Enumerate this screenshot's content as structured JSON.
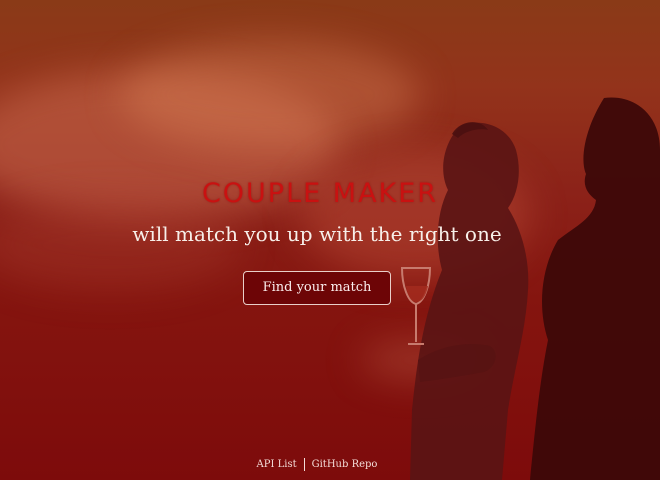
{
  "app": {
    "title": "COUPLE MAKER",
    "tagline": "will match you up with the right one"
  },
  "cta": {
    "label": "Find your match"
  },
  "footer": {
    "links": [
      {
        "label": "API List"
      },
      {
        "label": "GitHub Repo"
      }
    ]
  },
  "colors": {
    "title": "#c91111",
    "button_bg": "#6d0506",
    "overlay": "#7d0b0b"
  },
  "background_image": {
    "subject": "couple-silhouette-at-sunset"
  }
}
